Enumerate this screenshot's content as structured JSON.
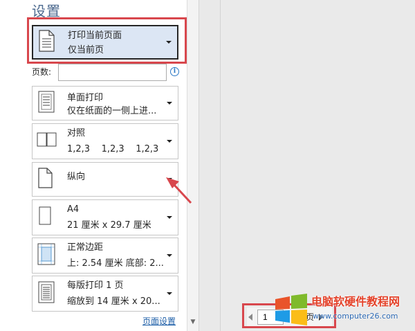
{
  "settings": {
    "title": "设置",
    "print_scope": {
      "line1": "打印当前页面",
      "line2": "仅当前页"
    },
    "pages": {
      "label": "页数:",
      "value": "",
      "info_icon": "info-icon"
    },
    "sides": {
      "line1": "单面打印",
      "line2": "仅在纸面的一侧上进..."
    },
    "collate": {
      "line1": "对照",
      "line2": "1,2,3    1,2,3    1,2,3"
    },
    "orientation": {
      "line1": "纵向"
    },
    "paper": {
      "line1": "A4",
      "line2": "21 厘米 x 29.7 厘米"
    },
    "margins": {
      "line1": "正常边距",
      "line2": "上: 2.54 厘米 底部: 2..."
    },
    "per_sheet": {
      "line1": "每版打印 1 页",
      "line2": "缩放到 14 厘米 x 20..."
    },
    "page_setup_link": "页面设置"
  },
  "pager": {
    "current": "1",
    "suffix": "页"
  },
  "watermark": {
    "title": "电脑软硬件教程网",
    "url": "www.computer26.com"
  },
  "colors": {
    "highlight_red": "#d8474d",
    "selected_bg": "#dce6f4",
    "title_blue": "#4d6a8f",
    "link_blue": "#1e5fa8"
  }
}
